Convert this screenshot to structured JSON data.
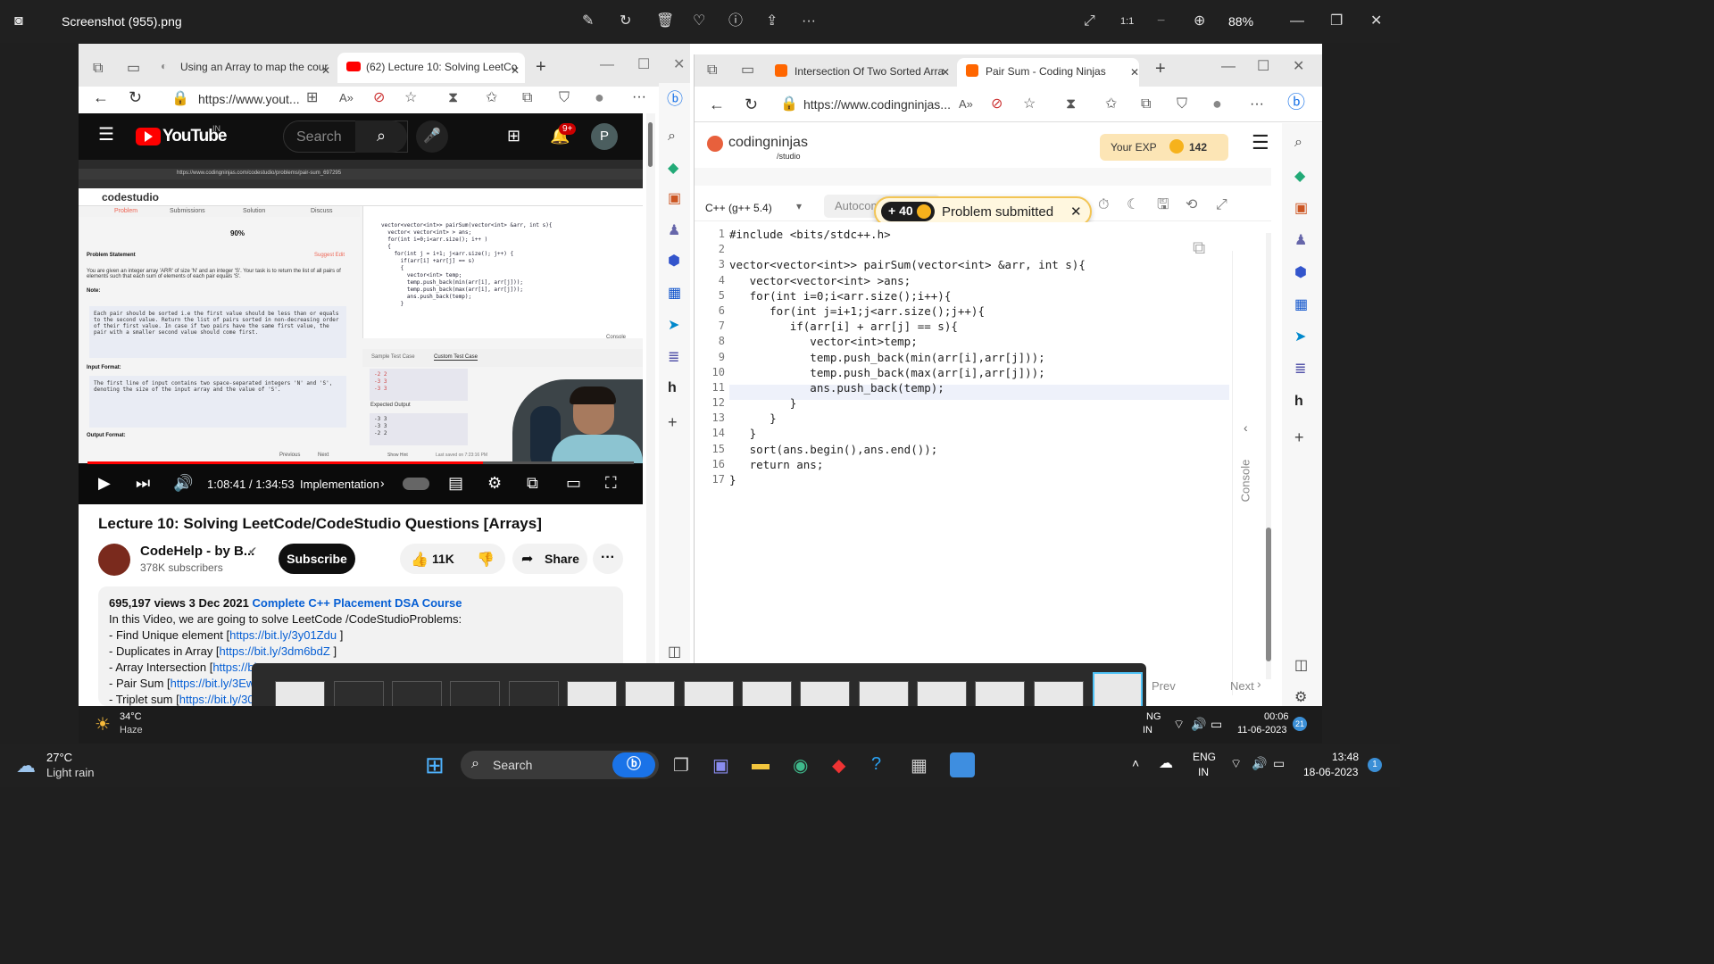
{
  "viewer": {
    "file_title": "Screenshot (955).png",
    "zoom": "88%"
  },
  "left_browser": {
    "tabs": [
      {
        "label": "Using an Array to map the cour"
      },
      {
        "label": "(62) Lecture 10: Solving LeetCo"
      }
    ],
    "url": "https://www.yout...",
    "youtube": {
      "logo": "YouTube",
      "region": "IN",
      "search_placeholder": "Search",
      "notif_count": "9+",
      "avatar": "P"
    },
    "video_content": {
      "site": "codestudio",
      "url_line": "https://www.codingninjas.com/codestudio/problems/pair-sum_697295",
      "tabs": [
        "Problem",
        "Submissions",
        "Solution",
        "Discuss"
      ],
      "success_rate": "90%",
      "problem_heading": "Problem Statement",
      "suggest": "Suggest Edit",
      "statement": "You are given an integer array 'ARR' of size 'N' and an integer 'S'. Your task is to return the list of all pairs of elements such that each sum of elements of each pair equals 'S'.",
      "note": "Note:",
      "note_text": "Each pair should be sorted i.e the first value should be less than or equals to the second value. Return the list of pairs sorted in non-decreasing order of their first value. In case if two pairs have the same first value, the pair with a smaller second value should come first.",
      "input_format": "Input Format:",
      "input_text": "The first line of input contains two space-separated integers 'N' and 'S', denoting the size of the input array and the value of 'S'.",
      "output_format": "Output Format:",
      "code_lines": [
        "vector<vector<int>> pairSum(vector<int> &arr, int s){",
        "  vector< vector<int> > ans;",
        "",
        "  for(int i=0;i<arr.size(); i++ )",
        "  {",
        "    for(int j = i+1; j<arr.size(); j++) {",
        "      if(arr[i] +arr[j] == s)",
        "      {",
        "        vector<int> temp;",
        "        temp.push_back(min(arr[i], arr[j]));",
        "        temp.push_back(max(arr[i], arr[j]));",
        "        ans.push_back(temp);",
        "      }"
      ],
      "test_tabs": [
        "Sample Test Case",
        "Custom Test Case"
      ],
      "test_input": [
        "-2 2",
        "-3 3",
        "-3 3"
      ],
      "expected_output": "Expected Output",
      "expected_values": [
        "-3 3",
        "-3 3",
        "-2 2"
      ],
      "console": "Console",
      "prev": "Previous",
      "next": "Next",
      "hint": "Show Hint",
      "saved": "Last saved on 7:23:16 PM"
    },
    "player": {
      "time": "1:08:41 / 1:34:53",
      "chapter": "Implementation",
      "progress": 0.724
    },
    "title": "Lecture 10: Solving LeetCode/CodeStudio Questions [Arrays]",
    "channel": "CodeHelp - by B...",
    "subscribers": "378K subscribers",
    "subscribe": "Subscribe",
    "likes": "11K",
    "share": "Share",
    "views_date": "695,197 views  3 Dec 2021",
    "playlist": "Complete C++ Placement DSA Course",
    "description": [
      "In this Video, we are going to solve LeetCode /CodeStudioProblems:",
      "- Find Unique element [",
      "- Duplicates in Array [",
      "- Array Intersection [",
      "- Pair Sum [",
      "- Triplet sum ["
    ],
    "links": [
      "https://bit.ly/3y01Zdu",
      "https://bit.ly/3dm6bdZ",
      "https://bi",
      "https://bit.ly/3Ew",
      "https://bit.ly/30"
    ],
    "link_suffix": [
      " ]",
      " ]",
      "",
      "",
      ""
    ]
  },
  "right_browser": {
    "tabs": [
      {
        "label": "Intersection Of Two Sorted Arra"
      },
      {
        "label": "Pair Sum - Coding Ninjas"
      }
    ],
    "url": "https://www.codingninjas...",
    "logo": "codingninjas",
    "logo_sub": "/studio",
    "exp_label": "Your EXP",
    "exp_value": "142",
    "language": "C++ (g++ 5.4)",
    "autocomplete": "Autocomplete",
    "toast_points": "+ 40",
    "toast_text": "Problem submitted",
    "code_lines": [
      "#include <bits/stdc++.h>",
      "",
      "vector<vector<int>> pairSum(vector<int> &arr, int s){",
      "   vector<vector<int> >ans;",
      "   for(int i=0;i<arr.size();i++){",
      "      for(int j=i+1;j<arr.size();j++){",
      "         if(arr[i] + arr[j] == s){",
      "            vector<int>temp;",
      "            temp.push_back(min(arr[i],arr[j]));",
      "            temp.push_back(max(arr[i],arr[j]));",
      "            ans.push_back(temp);",
      "         }",
      "      }",
      "   }",
      "   sort(ans.begin(),ans.end());",
      "   return ans;",
      "}"
    ],
    "line_numbers": [
      "1",
      "2",
      "3",
      "4",
      "5",
      "6",
      "7",
      "8",
      "9",
      "10",
      "11",
      "12",
      "13",
      "14",
      "15",
      "16",
      "17"
    ],
    "console": "Console",
    "prev": "Prev",
    "next": "Next"
  },
  "inner_taskbar": {
    "temp": "34°C",
    "weather": "Haze",
    "lang": "NG",
    "region": "IN",
    "time": "00:06",
    "date": "11-06-2023",
    "badge": "21"
  },
  "taskbar": {
    "temp": "27°C",
    "weather": "Light rain",
    "search": "Search",
    "lang": "ENG",
    "region": "IN",
    "time": "13:48",
    "date": "18-06-2023",
    "badge": "1"
  }
}
